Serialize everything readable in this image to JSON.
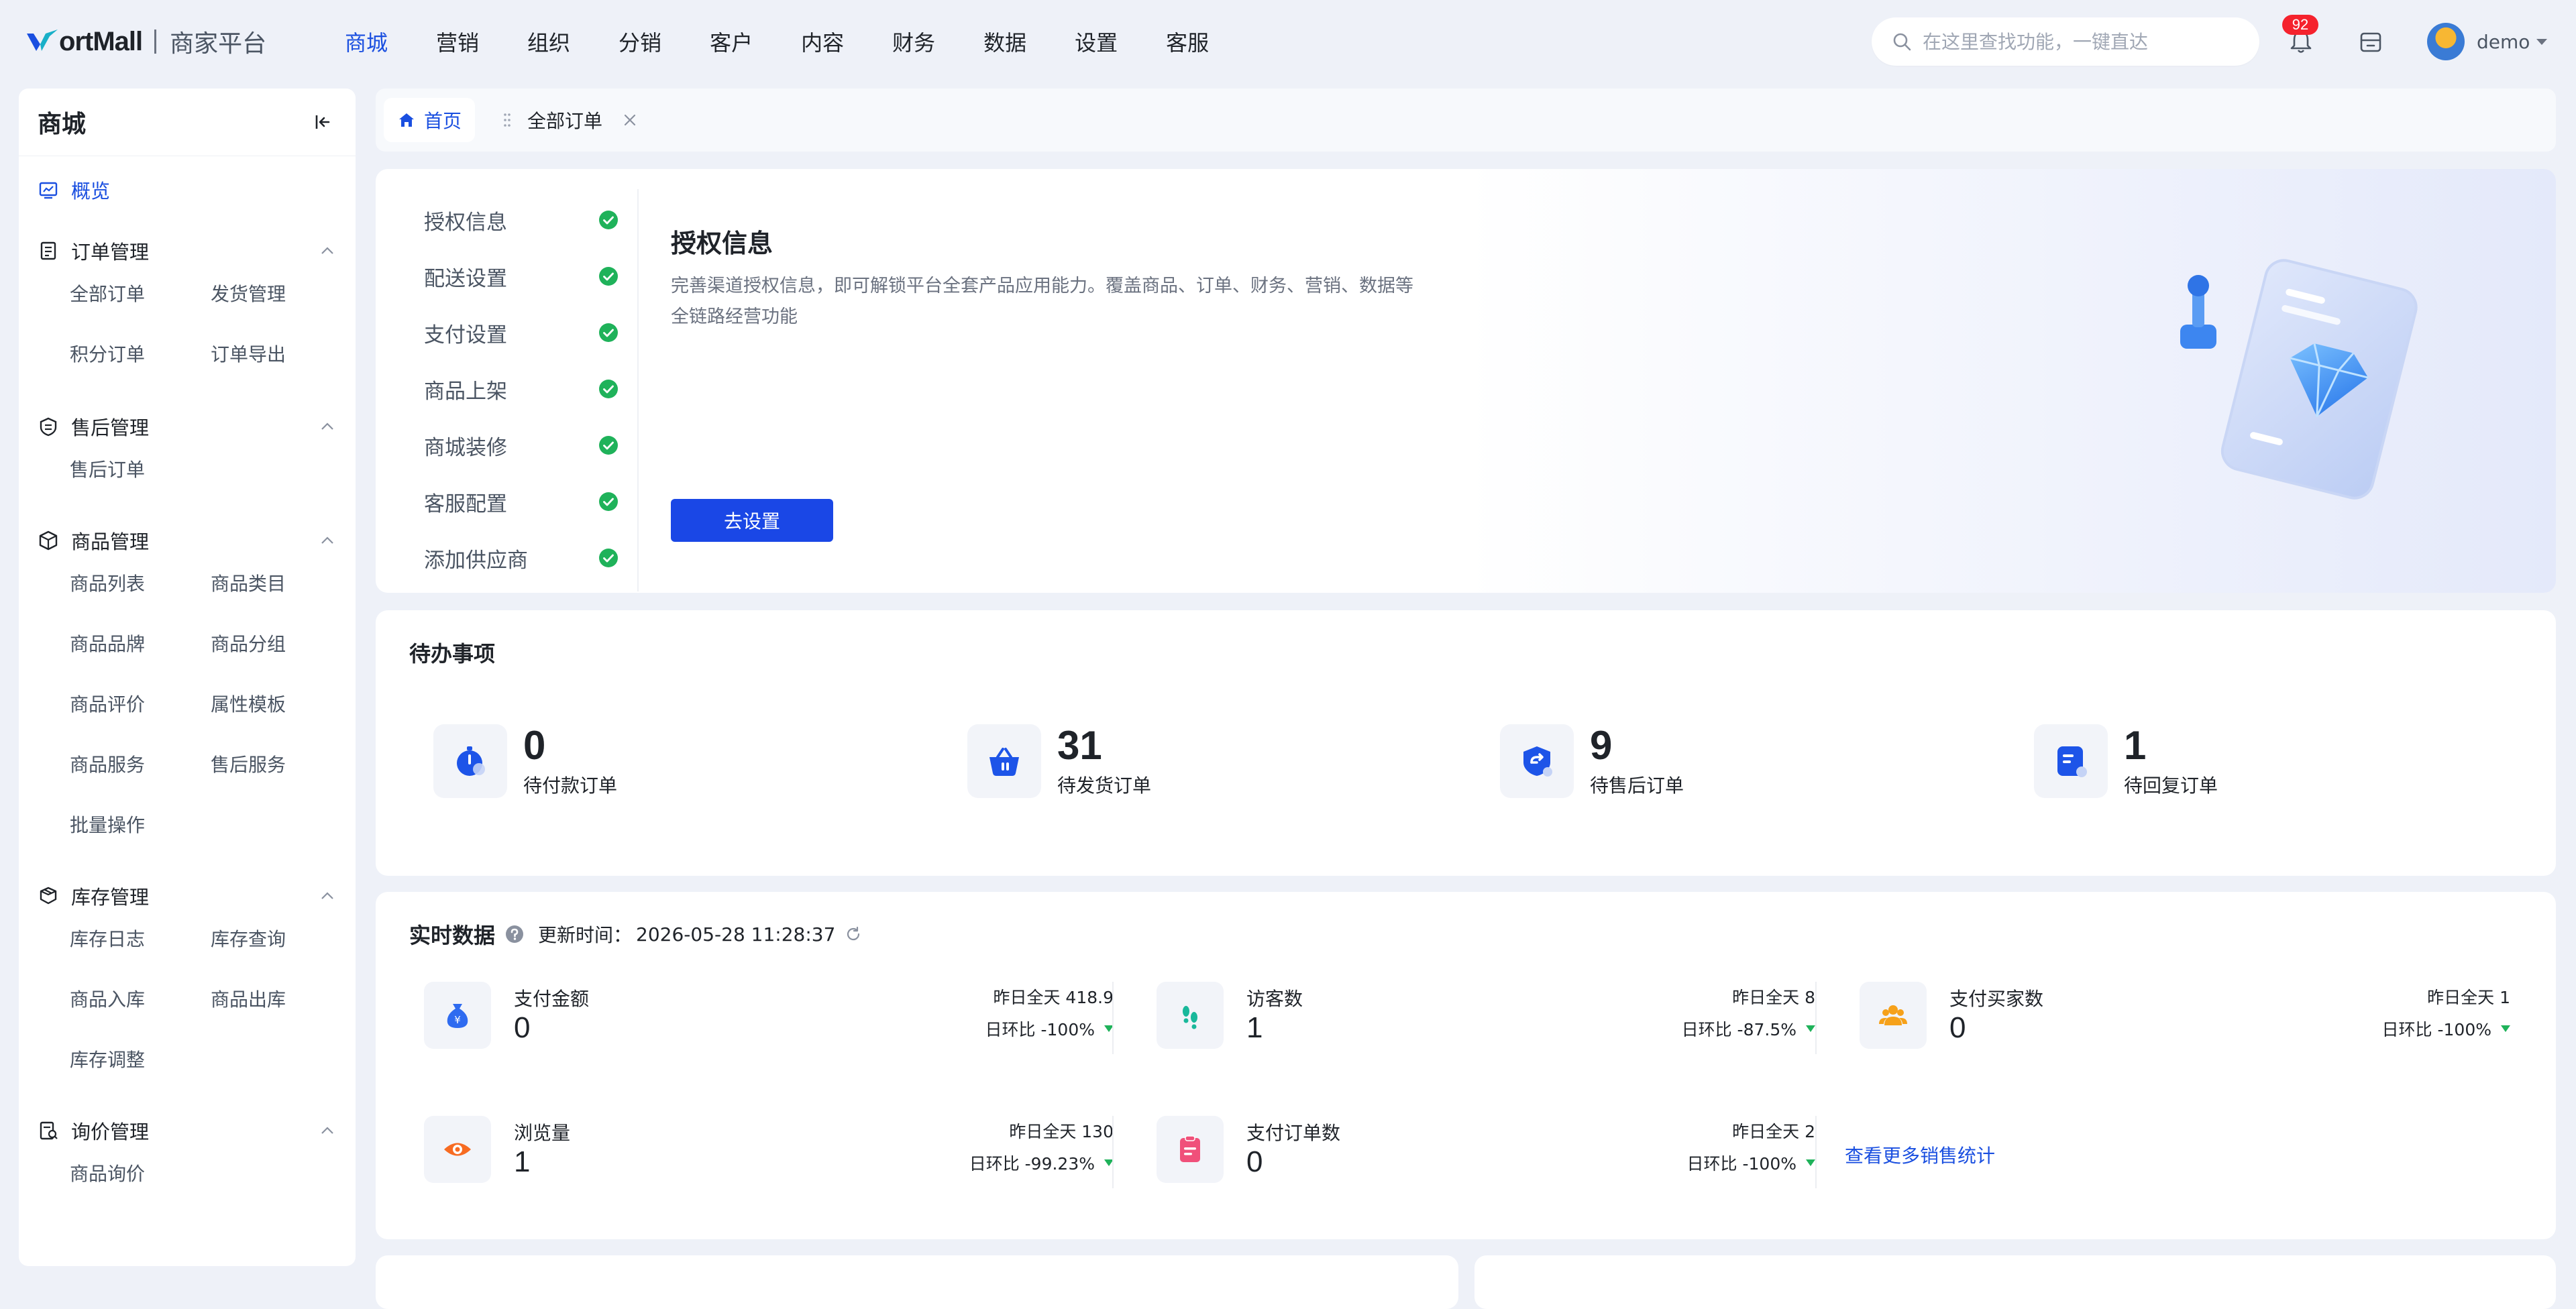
{
  "brand": {
    "logo_text": "ortMall",
    "sub_title": "商家平台"
  },
  "nav": [
    "商城",
    "营销",
    "组织",
    "分销",
    "客户",
    "内容",
    "财务",
    "数据",
    "设置",
    "客服"
  ],
  "search": {
    "placeholder": "在这里查找功能，一键直达"
  },
  "notifications": {
    "count": "92"
  },
  "user": {
    "name": "demo"
  },
  "sidebar": {
    "title": "商城",
    "overview": "概览",
    "groups": [
      {
        "label": "订单管理",
        "icon": "order-icon",
        "items": [
          "全部订单",
          "发货管理",
          "积分订单",
          "订单导出"
        ]
      },
      {
        "label": "售后管理",
        "icon": "after-sale-icon",
        "items": [
          "售后订单"
        ]
      },
      {
        "label": "商品管理",
        "icon": "goods-icon",
        "items": [
          "商品列表",
          "商品类目",
          "商品品牌",
          "商品分组",
          "商品评价",
          "属性模板",
          "商品服务",
          "售后服务",
          "批量操作"
        ]
      },
      {
        "label": "库存管理",
        "icon": "inventory-icon",
        "items": [
          "库存日志",
          "库存查询",
          "商品入库",
          "商品出库",
          "库存调整"
        ]
      },
      {
        "label": "询价管理",
        "icon": "inquiry-icon",
        "items": [
          "商品询价"
        ]
      }
    ]
  },
  "tabs": {
    "home": "首页",
    "current": "全部订单"
  },
  "auth": {
    "steps": [
      "授权信息",
      "配送设置",
      "支付设置",
      "商品上架",
      "商城装修",
      "客服配置",
      "添加供应商"
    ],
    "title": "授权信息",
    "description": "完善渠道授权信息，即可解锁平台全套产品应用能力。覆盖商品、订单、财务、营销、数据等全链路经营功能",
    "button": "去设置"
  },
  "todo": {
    "title": "待办事项",
    "items": [
      {
        "value": "0",
        "label": "待付款订单",
        "icon": "stopwatch-icon"
      },
      {
        "value": "31",
        "label": "待发货订单",
        "icon": "basket-icon"
      },
      {
        "value": "9",
        "label": "待售后订单",
        "icon": "return-icon"
      },
      {
        "value": "1",
        "label": "待回复订单",
        "icon": "reply-doc-icon"
      }
    ]
  },
  "realtime": {
    "title": "实时数据",
    "update_label": "更新时间：",
    "update_time": "2026-05-28 11:28:37",
    "metrics": [
      {
        "label": "支付金额",
        "value": "0",
        "yesterday": "昨日全天 418.9",
        "ratio": "日环比  -100%",
        "icon": "money-bag-icon",
        "color": "#2f6bf0"
      },
      {
        "label": "访客数",
        "value": "1",
        "yesterday": "昨日全天 8",
        "ratio": "日环比  -87.5%",
        "icon": "footprint-icon",
        "color": "#19b89b"
      },
      {
        "label": "支付买家数",
        "value": "0",
        "yesterday": "昨日全天 1",
        "ratio": "日环比  -100%",
        "icon": "buyers-icon",
        "color": "#f6a11a"
      },
      {
        "label": "浏览量",
        "value": "1",
        "yesterday": "昨日全天 130",
        "ratio": "日环比  -99.23%",
        "icon": "eye-icon",
        "color": "#f76b22"
      },
      {
        "label": "支付订单数",
        "value": "0",
        "yesterday": "昨日全天 2",
        "ratio": "日环比  -100%",
        "icon": "clipboard-icon",
        "color": "#f0507a"
      }
    ],
    "more_link": "查看更多销售统计"
  },
  "colors": {
    "accent": "#1a4fe0",
    "button": "#1a47e6",
    "success": "#1fb25a",
    "badge": "#f5222d"
  }
}
